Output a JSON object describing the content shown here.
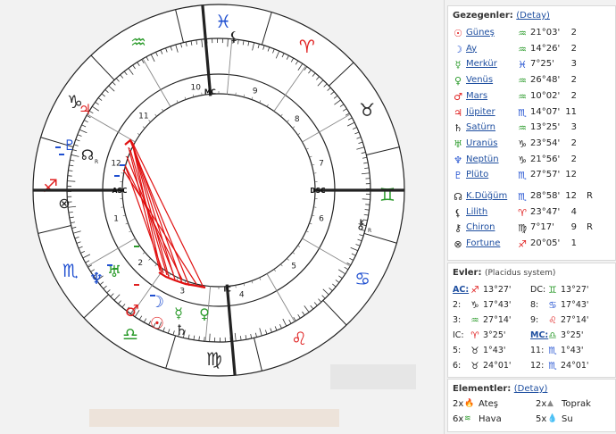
{
  "colors": {
    "fire": "#e02020",
    "earth": "#2e8b2e",
    "air": "#2a9a2a",
    "water": "#1f4fd0",
    "dark": "#222222",
    "aspect_red": "#e01010",
    "link": "#1f4fa0"
  },
  "wheel": {
    "house_numbers": [
      "1",
      "2",
      "3",
      "4",
      "5",
      "6",
      "7",
      "8",
      "9",
      "10",
      "11",
      "12"
    ],
    "axis_labels": {
      "asc": "ASC",
      "dsc": "DSC",
      "mc": "MC",
      "ic": "IC"
    },
    "signs": [
      {
        "glyph": "♒",
        "name": "aquarius-sign",
        "color": "#2a9a2a"
      },
      {
        "glyph": "♓",
        "name": "pisces-sign",
        "color": "#1f4fd0"
      },
      {
        "glyph": "♈",
        "name": "aries-sign",
        "color": "#e02020"
      },
      {
        "glyph": "♉",
        "name": "taurus-sign",
        "color": "#2a2a2a"
      },
      {
        "glyph": "♊",
        "name": "gemini-sign",
        "color": "#2a9a2a"
      },
      {
        "glyph": "♋",
        "name": "cancer-sign",
        "color": "#1f4fd0"
      },
      {
        "glyph": "♌",
        "name": "leo-sign",
        "color": "#e02020"
      },
      {
        "glyph": "♍",
        "name": "virgo-sign",
        "color": "#2a2a2a"
      },
      {
        "glyph": "♎",
        "name": "libra-sign",
        "color": "#2a9a2a"
      },
      {
        "glyph": "♏",
        "name": "scorpio-sign",
        "color": "#1f4fd0"
      },
      {
        "glyph": "♐",
        "name": "sagittarius-sign",
        "color": "#e02020"
      },
      {
        "glyph": "♑",
        "name": "capricorn-sign",
        "color": "#2a2a2a"
      }
    ],
    "planets": [
      {
        "glyph": "☉",
        "name": "sun-glyph",
        "color": "#e02020"
      },
      {
        "glyph": "☽",
        "name": "moon-glyph",
        "color": "#1f4fd0"
      },
      {
        "glyph": "☿",
        "name": "mercury-glyph",
        "color": "#2a9a2a"
      },
      {
        "glyph": "♀",
        "name": "venus-glyph",
        "color": "#2a9a2a"
      },
      {
        "glyph": "♂",
        "name": "mars-glyph",
        "color": "#e02020"
      },
      {
        "glyph": "♃",
        "name": "jupiter-glyph",
        "color": "#e02020"
      },
      {
        "glyph": "♄",
        "name": "saturn-glyph",
        "color": "#222222"
      },
      {
        "glyph": "♅",
        "name": "uranus-glyph",
        "color": "#2a9a2a"
      },
      {
        "glyph": "♆",
        "name": "neptune-glyph",
        "color": "#1f4fd0"
      },
      {
        "glyph": "♇",
        "name": "pluto-glyph",
        "color": "#1f4fd0"
      },
      {
        "glyph": "☊",
        "name": "north-node-glyph",
        "color": "#222222",
        "suffix": "R"
      },
      {
        "glyph": "⚸",
        "name": "lilith-glyph",
        "color": "#222222"
      },
      {
        "glyph": "⚷",
        "name": "chiron-glyph",
        "color": "#222222",
        "suffix": "R"
      },
      {
        "glyph": "⊗",
        "name": "fortune-glyph",
        "color": "#222222"
      }
    ]
  },
  "planets_panel": {
    "title": "Gezegenler:",
    "detail_link": "(Detay)",
    "rows": [
      {
        "glyph": "☉",
        "color": "#e02020",
        "name": "Güneş",
        "sign": "♒",
        "sign_color": "#2a9a2a",
        "degree": "21°03'",
        "house": "2",
        "retro": ""
      },
      {
        "glyph": "☽",
        "color": "#1f4fd0",
        "name": "Ay",
        "sign": "♒",
        "sign_color": "#2a9a2a",
        "degree": "14°26'",
        "house": "2",
        "retro": ""
      },
      {
        "glyph": "☿",
        "color": "#2a9a2a",
        "name": "Merkür",
        "sign": "♓",
        "sign_color": "#1f4fd0",
        "degree": "7°25'",
        "house": "3",
        "retro": ""
      },
      {
        "glyph": "♀",
        "color": "#2a9a2a",
        "name": "Venüs",
        "sign": "♒",
        "sign_color": "#2a9a2a",
        "degree": "26°48'",
        "house": "2",
        "retro": ""
      },
      {
        "glyph": "♂",
        "color": "#e02020",
        "name": "Mars",
        "sign": "♒",
        "sign_color": "#2a9a2a",
        "degree": "10°02'",
        "house": "2",
        "retro": ""
      },
      {
        "glyph": "♃",
        "color": "#e02020",
        "name": "Jüpiter",
        "sign": "♏",
        "sign_color": "#1f4fd0",
        "degree": "14°07'",
        "house": "11",
        "retro": ""
      },
      {
        "glyph": "♄",
        "color": "#222222",
        "name": "Satürn",
        "sign": "♒",
        "sign_color": "#2a9a2a",
        "degree": "13°25'",
        "house": "3",
        "retro": ""
      },
      {
        "glyph": "♅",
        "color": "#2a9a2a",
        "name": "Uranüs",
        "sign": "♑",
        "sign_color": "#222222",
        "degree": "23°54'",
        "house": "2",
        "retro": ""
      },
      {
        "glyph": "♆",
        "color": "#1f4fd0",
        "name": "Neptün",
        "sign": "♑",
        "sign_color": "#222222",
        "degree": "21°56'",
        "house": "2",
        "retro": ""
      },
      {
        "glyph": "♇",
        "color": "#1f4fd0",
        "name": "Plüto",
        "sign": "♏",
        "sign_color": "#1f4fd0",
        "degree": "27°57'",
        "house": "12",
        "retro": ""
      },
      {
        "glyph": "☊",
        "color": "#222222",
        "name": "K.Düğüm",
        "sign": "♏",
        "sign_color": "#1f4fd0",
        "degree": "28°58'",
        "house": "12",
        "retro": "R"
      },
      {
        "glyph": "⚸",
        "color": "#222222",
        "name": "Lilith",
        "sign": "♈",
        "sign_color": "#e02020",
        "degree": "23°47'",
        "house": "4",
        "retro": ""
      },
      {
        "glyph": "⚷",
        "color": "#222222",
        "name": "Chiron",
        "sign": "♍",
        "sign_color": "#222222",
        "degree": "7°17'",
        "house": "9",
        "retro": "R"
      },
      {
        "glyph": "⊗",
        "color": "#222222",
        "name": "Fortune",
        "sign": "♐",
        "sign_color": "#e02020",
        "degree": "20°05'",
        "house": "1",
        "retro": ""
      }
    ]
  },
  "houses_panel": {
    "title": "Evler:",
    "system": "(Placidus system)",
    "rows": [
      {
        "l1": "AC:",
        "s1": "♐",
        "c1": "#e02020",
        "d1": "13°27'",
        "l2": "DC:",
        "s2": "♊",
        "c2": "#2a9a2a",
        "d2": "13°27'"
      },
      {
        "l1": "2:",
        "s1": "♑",
        "c1": "#222222",
        "d1": "17°43'",
        "l2": "8:",
        "s2": "♋",
        "c2": "#1f4fd0",
        "d2": "17°43'"
      },
      {
        "l1": "3:",
        "s1": "♒",
        "c1": "#2a9a2a",
        "d1": "27°14'",
        "l2": "9:",
        "s2": "♌",
        "c2": "#e02020",
        "d2": "27°14'"
      },
      {
        "l1": "IC:",
        "s1": "♈",
        "c1": "#e02020",
        "d1": "3°25'",
        "l2": "MC:",
        "s2": "♎",
        "c2": "#2a9a2a",
        "d2": "3°25'"
      },
      {
        "l1": "5:",
        "s1": "♉",
        "c1": "#222222",
        "d1": "1°43'",
        "l2": "11:",
        "s2": "♏",
        "c2": "#1f4fd0",
        "d2": "1°43'"
      },
      {
        "l1": "6:",
        "s1": "♉",
        "c1": "#222222",
        "d1": "24°01'",
        "l2": "12:",
        "s2": "♏",
        "c2": "#1f4fd0",
        "d2": "24°01'"
      }
    ]
  },
  "elements_panel": {
    "title": "Elementler:",
    "detail_link": "(Detay)",
    "items": [
      {
        "count": "2x",
        "icon": "🔥",
        "icon_color": "#e0501a",
        "label": "Ateş"
      },
      {
        "count": "2x",
        "icon": "▲",
        "icon_color": "#888888",
        "label": "Toprak"
      },
      {
        "count": "6x",
        "icon": "≋",
        "icon_color": "#2a9a2a",
        "label": "Hava"
      },
      {
        "count": "5x",
        "icon": "💧",
        "icon_color": "#1f4fd0",
        "label": "Su"
      }
    ]
  }
}
